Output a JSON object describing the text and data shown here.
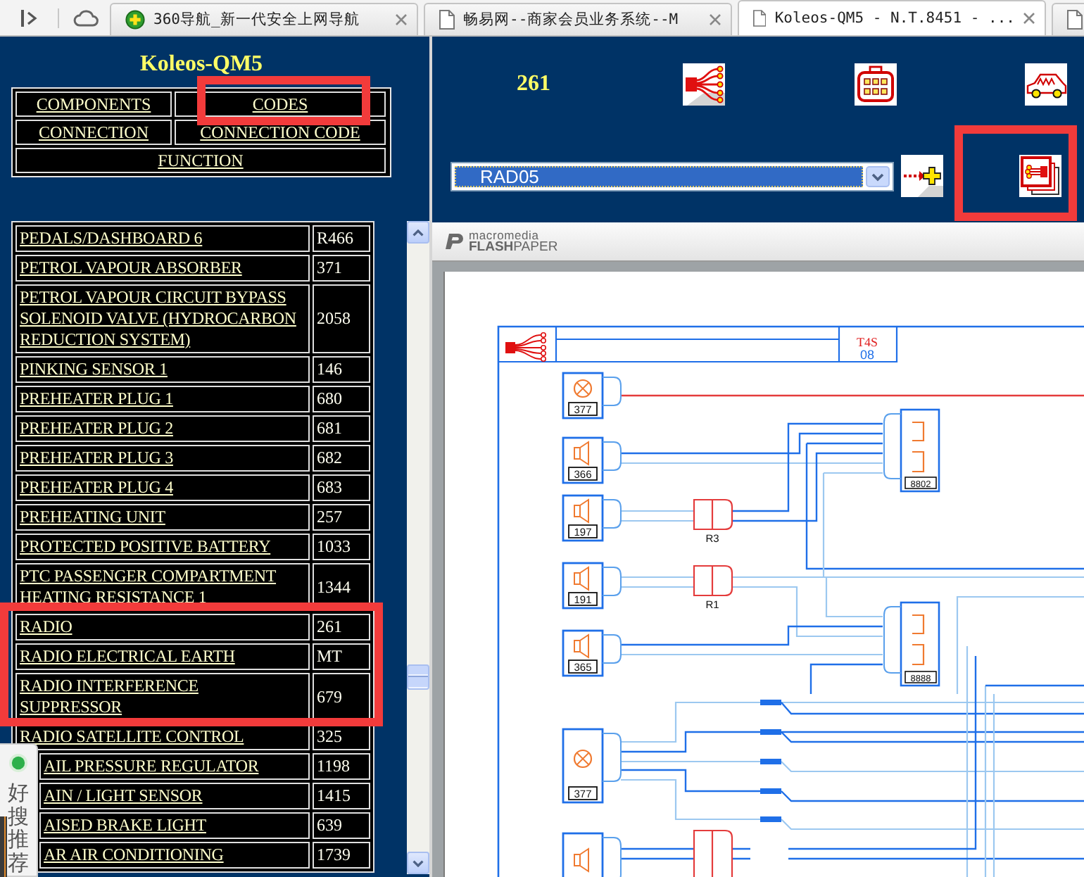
{
  "browser": {
    "tabs": [
      {
        "kind": "site",
        "title": "360导航_新一代安全上网导航",
        "selected": false
      },
      {
        "kind": "page",
        "title": "畅易网--商家会员业务系统--M",
        "selected": false
      },
      {
        "kind": "page",
        "title": "Koleos-QM5 - N.T.8451 - ...",
        "selected": true
      },
      {
        "kind": "page",
        "selected": false
      }
    ]
  },
  "left": {
    "title": "Koleos-QM5",
    "nav": [
      [
        "COMPONENTS",
        "CODES"
      ],
      [
        "CONNECTION",
        "CONNECTION CODE"
      ],
      [
        "FUNCTION"
      ]
    ],
    "components": [
      {
        "kind": "full",
        "name": "PEDALS/DASHBOARD 6",
        "code": "R466"
      },
      {
        "kind": "full",
        "name": "PETROL VAPOUR ABSORBER",
        "code": "371"
      },
      {
        "kind": "full",
        "name": "PETROL VAPOUR CIRCUIT BYPASS SOLENOID VALVE (HYDROCARBON REDUCTION SYSTEM)",
        "code": "2058"
      },
      {
        "kind": "full",
        "name": "PINKING SENSOR 1",
        "code": "146"
      },
      {
        "kind": "full",
        "name": "PREHEATER PLUG 1",
        "code": "680"
      },
      {
        "kind": "full",
        "name": "PREHEATER PLUG 2",
        "code": "681"
      },
      {
        "kind": "full",
        "name": "PREHEATER PLUG 3",
        "code": "682"
      },
      {
        "kind": "full",
        "name": "PREHEATER PLUG 4",
        "code": "683"
      },
      {
        "kind": "full",
        "name": "PREHEATING UNIT",
        "code": "257"
      },
      {
        "kind": "full",
        "name": "PROTECTED POSITIVE BATTERY",
        "code": "1033"
      },
      {
        "kind": "full",
        "name": "PTC PASSENGER COMPARTMENT HEATING RESISTANCE 1",
        "code": "1344"
      },
      {
        "kind": "full",
        "name": "RADIO",
        "code": "261"
      },
      {
        "kind": "full",
        "name": "RADIO ELECTRICAL EARTH",
        "code": "MT"
      },
      {
        "kind": "full",
        "name": "RADIO INTERFERENCE\nSUPPRESSOR",
        "code": "679"
      },
      {
        "kind": "full",
        "name": "RADIO SATELLITE CONTROL",
        "code": "325"
      },
      {
        "kind": "covered",
        "name": "AIL PRESSURE REGULATOR",
        "code": "1198"
      },
      {
        "kind": "covered",
        "name": "AIN / LIGHT SENSOR",
        "code": "1415"
      },
      {
        "kind": "covered",
        "name": "AISED BRAKE LIGHT",
        "code": "639"
      },
      {
        "kind": "covered",
        "name": "AR AIR CONDITIONING",
        "code": "1739"
      }
    ]
  },
  "widget": {
    "label": "好搜推荐"
  },
  "header": {
    "code": "261",
    "dropdown": {
      "value": "RAD05"
    }
  },
  "viewer": {
    "brand_top": "macromedia",
    "brand": "**FLASH**PAPER"
  },
  "schematic": {
    "sheet": "T4S",
    "page": "08",
    "devices": [
      {
        "kind": "round",
        "code": "377"
      },
      {
        "kind": "speaker",
        "code": "366"
      },
      {
        "kind": "speaker",
        "code": "197"
      },
      {
        "kind": "speaker",
        "code": "191"
      },
      {
        "kind": "speaker",
        "code": "365"
      },
      {
        "kind": "round",
        "code": "377"
      },
      {
        "kind": "speaker"
      }
    ],
    "connectors": [
      {
        "code": "R3"
      },
      {
        "code": "R1"
      }
    ],
    "modules": [
      {
        "code": "8802"
      },
      {
        "code": "8888"
      }
    ]
  }
}
